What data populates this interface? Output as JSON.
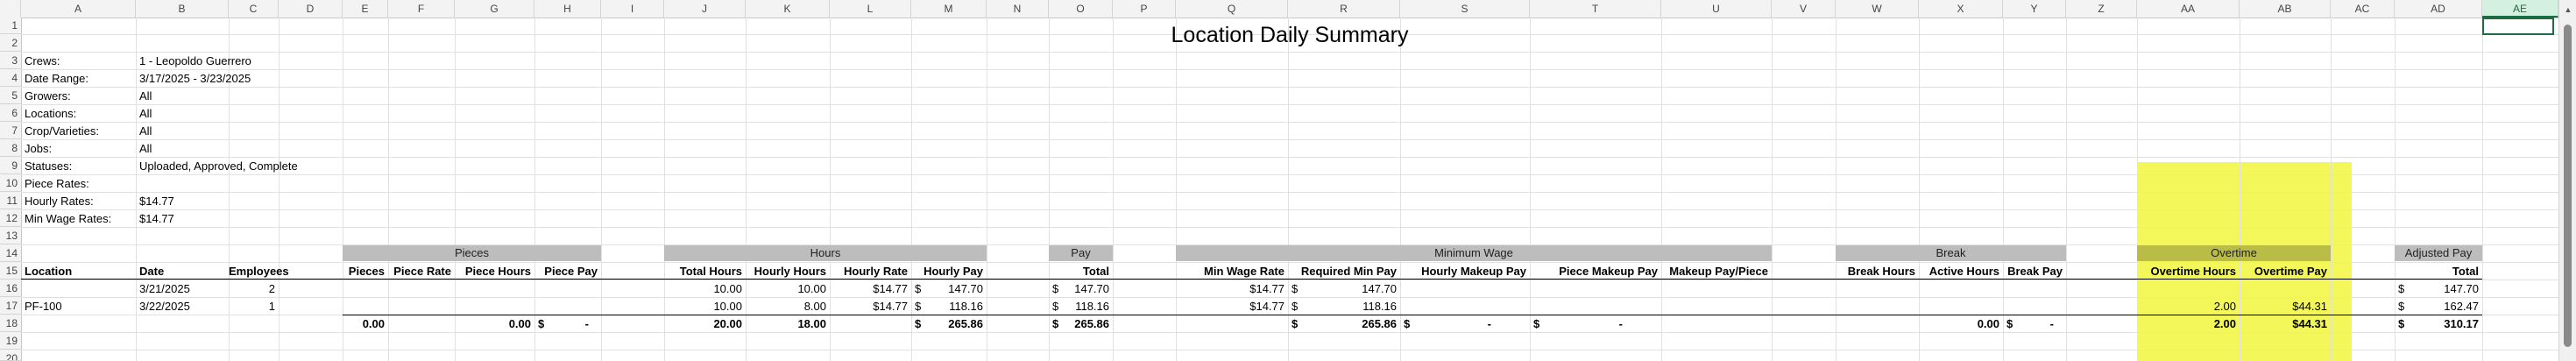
{
  "title": "Location Daily Summary",
  "columns": [
    "A",
    "B",
    "C",
    "D",
    "E",
    "F",
    "G",
    "H",
    "I",
    "J",
    "K",
    "L",
    "M",
    "N",
    "O",
    "P",
    "Q",
    "R",
    "S",
    "T",
    "U",
    "V",
    "W",
    "X",
    "Y",
    "Z",
    "AA",
    "AB",
    "AC",
    "AD",
    "AE"
  ],
  "rows": [
    "1",
    "2",
    "3",
    "4",
    "5",
    "6",
    "7",
    "8",
    "9",
    "10",
    "11",
    "12",
    "13",
    "14",
    "15",
    "16",
    "17",
    "18",
    "19",
    "20"
  ],
  "filters": [
    {
      "label": "Crews:",
      "value": "1 - Leopoldo Guerrero"
    },
    {
      "label": "Date Range:",
      "value": "3/17/2025 - 3/23/2025"
    },
    {
      "label": "Growers:",
      "value": "All"
    },
    {
      "label": "Locations:",
      "value": "All"
    },
    {
      "label": "Crop/Varieties:",
      "value": "All"
    },
    {
      "label": "Jobs:",
      "value": "All"
    },
    {
      "label": "Statuses:",
      "value": "Uploaded, Approved, Complete"
    },
    {
      "label": "Piece Rates:",
      "value": ""
    },
    {
      "label": "Hourly Rates:",
      "value": "$14.77"
    },
    {
      "label": "Min Wage Rates:",
      "value": "$14.77"
    }
  ],
  "groups": {
    "pieces": "Pieces",
    "hours": "Hours",
    "pay": "Pay",
    "minimum_wage": "Minimum Wage",
    "break": "Break",
    "overtime": "Overtime",
    "adjusted_pay": "Adjusted Pay"
  },
  "headers": {
    "location": "Location",
    "date": "Date",
    "employees": "Employees",
    "pieces": "Pieces",
    "piece_rate": "Piece Rate",
    "piece_hours": "Piece Hours",
    "piece_pay": "Piece Pay",
    "total_hours": "Total Hours",
    "hourly_hours": "Hourly Hours",
    "hourly_rate": "Hourly Rate",
    "hourly_pay": "Hourly Pay",
    "pay_total": "Total",
    "min_wage_rate": "Min Wage Rate",
    "required_min_pay": "Required Min Pay",
    "hourly_makeup_pay": "Hourly Makeup Pay",
    "piece_makeup_pay": "Piece Makeup Pay",
    "makeup_pay_piece": "Makeup Pay/Piece",
    "break_hours": "Break Hours",
    "active_hours": "Active Hours",
    "break_pay": "Break Pay",
    "overtime_hours": "Overtime Hours",
    "overtime_pay": "Overtime Pay",
    "adjusted_total": "Total"
  },
  "currency": "$",
  "dash": "-",
  "data_rows": [
    {
      "location": "",
      "date": "3/21/2025",
      "employees": "2",
      "total_hours": "10.00",
      "hourly_hours": "10.00",
      "hourly_rate": "$14.77",
      "hourly_pay": "147.70",
      "pay_total": "147.70",
      "min_wage_rate": "$14.77",
      "required_min_pay": "147.70",
      "overtime_hours": "",
      "overtime_pay": "",
      "adjusted_total": "147.70"
    },
    {
      "location": "PF-100",
      "date": "3/22/2025",
      "employees": "1",
      "total_hours": "10.00",
      "hourly_hours": "8.00",
      "hourly_rate": "$14.77",
      "hourly_pay": "118.16",
      "pay_total": "118.16",
      "min_wage_rate": "$14.77",
      "required_min_pay": "118.16",
      "overtime_hours": "2.00",
      "overtime_pay": "$44.31",
      "adjusted_total": "162.47"
    }
  ],
  "totals": {
    "pieces": "0.00",
    "piece_hours": "0.00",
    "total_hours": "20.00",
    "hourly_hours": "18.00",
    "hourly_pay": "265.86",
    "pay_total": "265.86",
    "required_min_pay": "265.86",
    "active_hours": "0.00",
    "overtime_hours": "2.00",
    "overtime_pay": "$44.31",
    "adjusted_total": "310.17"
  },
  "colors": {
    "highlight": "#f3f75a",
    "band": "#bdbdbd",
    "selection": "#1e6c41"
  },
  "selected_cell": "AE1"
}
